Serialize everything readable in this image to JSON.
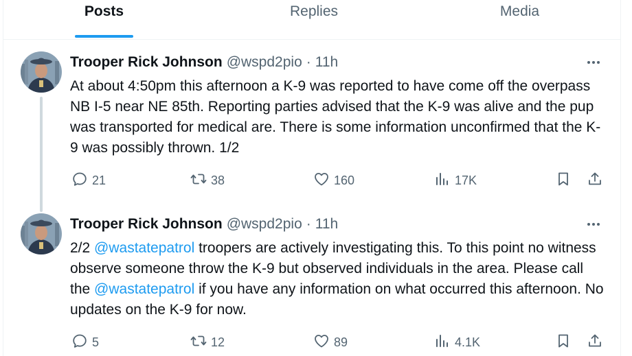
{
  "tabs": [
    {
      "label": "Posts",
      "active": true
    },
    {
      "label": "Replies",
      "active": false
    },
    {
      "label": "Media",
      "active": false
    }
  ],
  "posts": [
    {
      "name": "Trooper Rick Johnson",
      "handle": "@wspd2pio",
      "sep": "·",
      "time": "11h",
      "text_parts": [
        {
          "t": "At about 4:50pm this afternoon a K-9 was reported to have come off the overpass NB I-5 near NE 85th.  Reporting parties advised that the K-9 was alive and the pup was transported for medical are.  There is some information unconfirmed that the K-9 was possibly thrown. 1/2"
        }
      ],
      "replies": "21",
      "reposts": "38",
      "likes": "160",
      "views": "17K"
    },
    {
      "name": "Trooper Rick Johnson",
      "handle": "@wspd2pio",
      "sep": "·",
      "time": "11h",
      "text_parts": [
        {
          "t": "2/2  "
        },
        {
          "m": "@wastatepatrol"
        },
        {
          "t": " troopers are actively investigating this.  To this point no witness observe someone throw the K-9 but observed individuals in the area.  Please call the "
        },
        {
          "m": "@wastatepatrol"
        },
        {
          "t": " if you have any information on what occurred this afternoon.  No updates on the K-9 for now."
        }
      ],
      "replies": "5",
      "reposts": "12",
      "likes": "89",
      "views": "4.1K"
    }
  ],
  "icons": {
    "reply": "reply-icon",
    "repost": "repost-icon",
    "like": "heart-icon",
    "views": "views-icon",
    "bookmark": "bookmark-icon",
    "share": "share-icon",
    "more": "more-icon"
  },
  "colors": {
    "accent": "#1d9bf0",
    "muted": "#536471",
    "text": "#0f1419",
    "border": "#eff3f4"
  }
}
